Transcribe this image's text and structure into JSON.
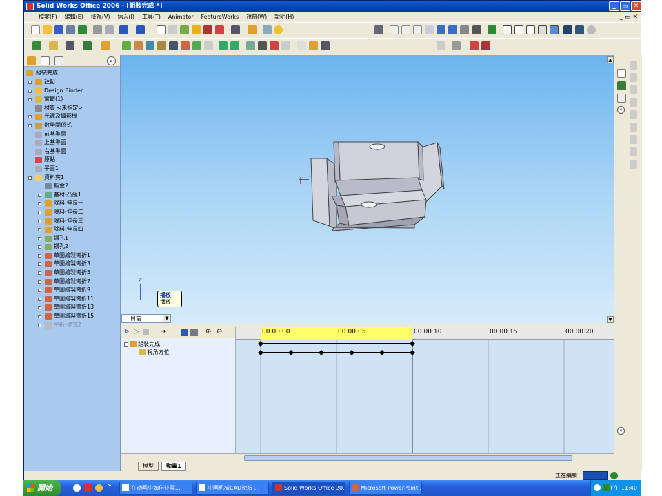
{
  "window": {
    "title": "Solid Works Office 2006 - [組裝完成 *]"
  },
  "menu": [
    "檔案(F)",
    "編輯(E)",
    "檢視(V)",
    "插入(I)",
    "工具(T)",
    "Animator",
    "FeatureWorks",
    "視窗(W)",
    "說明(H)"
  ],
  "feature_tree": {
    "root": "組裝完成",
    "items": [
      {
        "label": "註記",
        "level": 1,
        "icon": "annotation-icon",
        "expand": true
      },
      {
        "label": "Design Binder",
        "level": 1,
        "icon": "binder-icon",
        "expand": true
      },
      {
        "label": "實體(1)",
        "level": 1,
        "icon": "solid-body-icon",
        "expand": true
      },
      {
        "label": "材質 <未指定>",
        "level": 1,
        "icon": "material-icon",
        "expand": false
      },
      {
        "label": "光源及攝影機",
        "level": 1,
        "icon": "lights-icon",
        "expand": true
      },
      {
        "label": "數學關係式",
        "level": 1,
        "icon": "equations-icon",
        "expand": true
      },
      {
        "label": "前基準面",
        "level": 1,
        "icon": "plane-icon",
        "expand": false
      },
      {
        "label": "上基準面",
        "level": 1,
        "icon": "plane-icon",
        "expand": false
      },
      {
        "label": "右基準面",
        "level": 1,
        "icon": "plane-icon",
        "expand": false
      },
      {
        "label": "原點",
        "level": 1,
        "icon": "origin-icon",
        "expand": false
      },
      {
        "label": "平面1",
        "level": 1,
        "icon": "plane-icon",
        "expand": false
      },
      {
        "label": "資料夾1",
        "level": 1,
        "icon": "folder-icon",
        "expand": "open"
      },
      {
        "label": "鈑金2",
        "level": 2,
        "icon": "sheet-metal-icon",
        "expand": false
      },
      {
        "label": "基材-凸緣1",
        "level": 2,
        "icon": "base-flange-icon",
        "expand": true
      },
      {
        "label": "除料-伸長一",
        "level": 2,
        "icon": "cut-extrude-icon",
        "expand": true
      },
      {
        "label": "除料-伸長二",
        "level": 2,
        "icon": "cut-extrude-icon",
        "expand": true
      },
      {
        "label": "除料-伸長三",
        "level": 2,
        "icon": "cut-extrude-icon",
        "expand": true
      },
      {
        "label": "除料-伸長四",
        "level": 2,
        "icon": "cut-extrude-icon",
        "expand": true
      },
      {
        "label": "鑽孔1",
        "level": 2,
        "icon": "hole-icon",
        "expand": true
      },
      {
        "label": "鑽孔2",
        "level": 2,
        "icon": "hole-icon",
        "expand": true
      },
      {
        "label": "草圖繪製彎折1",
        "level": 2,
        "icon": "sketched-bend-icon",
        "expand": true
      },
      {
        "label": "草圖繪製彎折3",
        "level": 2,
        "icon": "sketched-bend-icon",
        "expand": true
      },
      {
        "label": "草圖繪製彎折5",
        "level": 2,
        "icon": "sketched-bend-icon",
        "expand": true
      },
      {
        "label": "草圖繪製彎折7",
        "level": 2,
        "icon": "sketched-bend-icon",
        "expand": true
      },
      {
        "label": "草圖繪製彎折9",
        "level": 2,
        "icon": "sketched-bend-icon",
        "expand": true
      },
      {
        "label": "草圖繪製彎折11",
        "level": 2,
        "icon": "sketched-bend-icon",
        "expand": true
      },
      {
        "label": "草圖繪製彎折13",
        "level": 2,
        "icon": "sketched-bend-icon",
        "expand": true
      },
      {
        "label": "草圖繪製彎折15",
        "level": 2,
        "icon": "sketched-bend-icon",
        "expand": true
      },
      {
        "label": "平板-型式2",
        "level": 2,
        "icon": "flat-pattern-icon",
        "expand": true,
        "dim": true
      }
    ]
  },
  "tooltip": {
    "title": "播放",
    "body": "播放"
  },
  "view_combo": "目前",
  "timeline": {
    "tree_root": "組裝完成",
    "tree_child": "視角方位",
    "ruler": [
      "00:00:00",
      "00:00:05",
      "00:00:10",
      "00:00:15",
      "00:00:20"
    ],
    "tabs": [
      "模型",
      "動畫1"
    ]
  },
  "status": {
    "text": "正在編輯"
  },
  "taskbar": {
    "start": "開始",
    "tasks": [
      "在动画中如何让零...",
      "中国机械CAD论坛 ...",
      "Solid Works Office 20...",
      "Microsoft PowerPoint ..."
    ],
    "clock": "下午 11:40"
  }
}
